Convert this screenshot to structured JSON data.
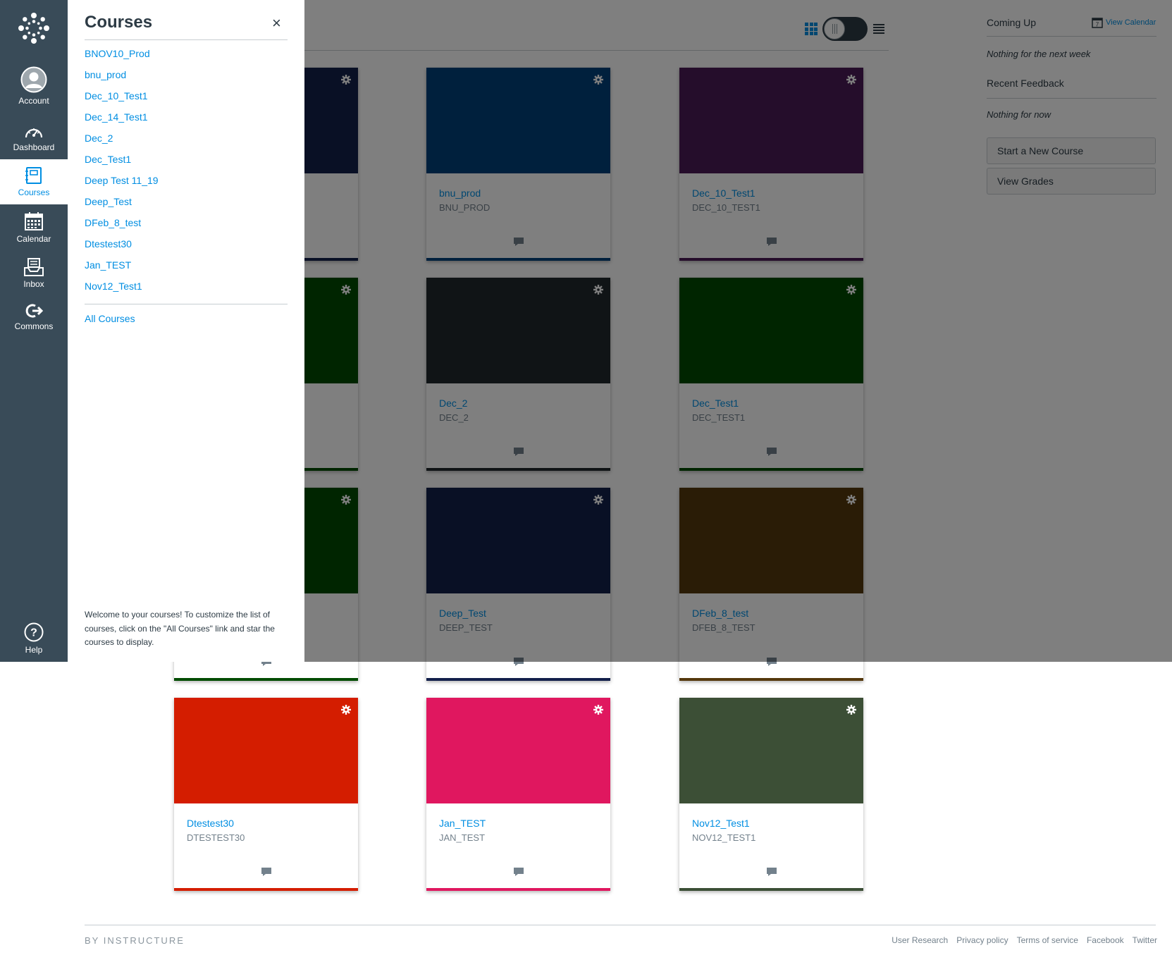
{
  "global_nav": {
    "account": "Account",
    "dashboard": "Dashboard",
    "courses": "Courses",
    "calendar": "Calendar",
    "inbox": "Inbox",
    "commons": "Commons",
    "help": "Help"
  },
  "courses_tray": {
    "title": "Courses",
    "close_glyph": "×",
    "items": [
      "BNOV10_Prod",
      "bnu_prod",
      "Dec_10_Test1",
      "Dec_14_Test1",
      "Dec_2",
      "Dec_Test1",
      "Deep Test 11_19",
      "Deep_Test",
      "DFeb_8_test",
      "Dtestest30",
      "Jan_TEST",
      "Nov12_Test1"
    ],
    "all_courses": "All Courses",
    "welcome": "Welcome to your courses! To customize the list of courses, click on the \"All Courses\" link and star the courses to display."
  },
  "dashboard": {
    "cards": [
      {
        "name": "",
        "code": "",
        "color": "#13204b"
      },
      {
        "name": "bnu_prod",
        "code": "BNU_PROD",
        "color": "#01407a"
      },
      {
        "name": "Dec_10_Test1",
        "code": "DEC_10_TEST1",
        "color": "#4a1b57"
      },
      {
        "name": "",
        "code": "",
        "color": "#004b00"
      },
      {
        "name": "Dec_2",
        "code": "DEC_2",
        "color": "#20292d"
      },
      {
        "name": "Dec_Test1",
        "code": "DEC_TEST1",
        "color": "#004b00"
      },
      {
        "name": "",
        "code": "",
        "color": "#004b00"
      },
      {
        "name": "Deep_Test",
        "code": "DEEP_TEST",
        "color": "#13204b"
      },
      {
        "name": "DFeb_8_test",
        "code": "DFEB_8_TEST",
        "color": "#55380d"
      },
      {
        "name": "Dtestest30",
        "code": "DTESTEST30",
        "color": "#d41d00"
      },
      {
        "name": "Jan_TEST",
        "code": "JAN_TEST",
        "color": "#e0175f"
      },
      {
        "name": "Nov12_Test1",
        "code": "NOV12_TEST1",
        "color": "#3c4f36"
      }
    ]
  },
  "aside": {
    "coming_up": "Coming Up",
    "view_calendar": "View Calendar",
    "calendar_day": "7",
    "nothing_next_week": "Nothing for the next week",
    "recent_feedback": "Recent Feedback",
    "nothing_for_now": "Nothing for now",
    "start_new_course": "Start a New Course",
    "view_grades": "View Grades"
  },
  "footer": {
    "brand": "BY INSTRUCTURE",
    "links": [
      "User Research",
      "Privacy policy",
      "Terms of service",
      "Facebook",
      "Twitter"
    ]
  },
  "colors": {
    "nav_bg": "#394b58",
    "link": "#008ee2"
  }
}
